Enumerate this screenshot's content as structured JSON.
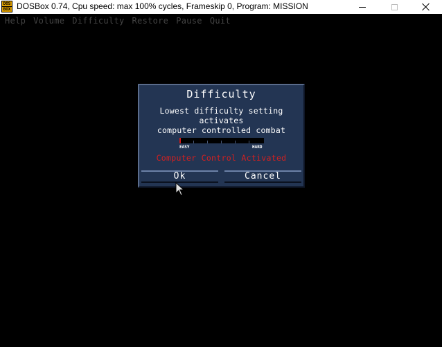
{
  "window": {
    "title": "DOSBox 0.74, Cpu speed: max 100% cycles, Frameskip  0, Program:  MISSION",
    "icon_top": "DOS",
    "icon_bottom": "BOX"
  },
  "menu": {
    "items": [
      "Help",
      "Volume",
      "Difficulty",
      "Restore",
      "Pause",
      "Quit"
    ]
  },
  "dialog": {
    "title": "Difficulty",
    "message_line1": "Lowest difficulty setting activates",
    "message_line2": "computer controlled combat",
    "slider": {
      "min_label": "EASY",
      "max_label": "HARD",
      "value": 0
    },
    "status": "Computer Control Activated",
    "ok_label": "Ok",
    "cancel_label": "Cancel"
  },
  "colors": {
    "dialog_bg": "#233553",
    "status_text": "#d42020",
    "slider_thumb": "#d01818"
  }
}
